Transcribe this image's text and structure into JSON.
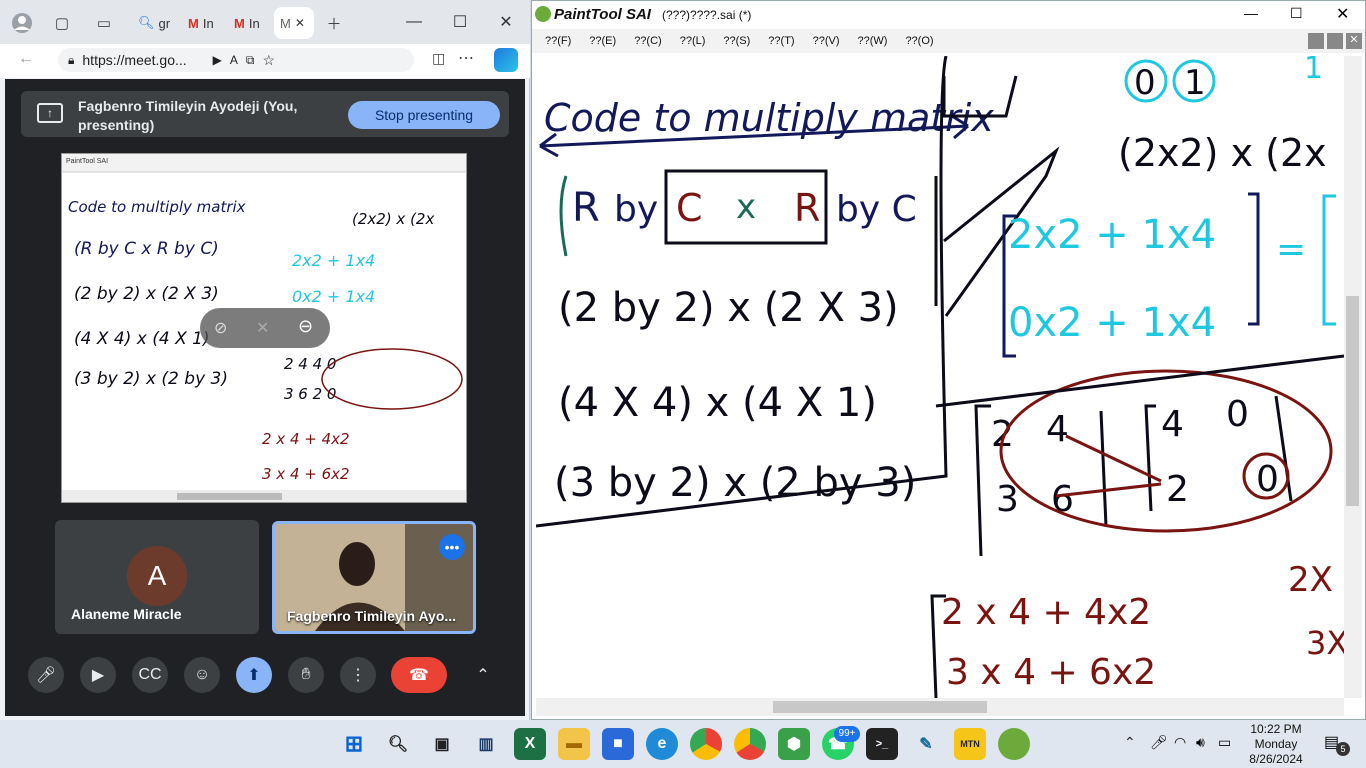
{
  "browser": {
    "tabs": [
      {
        "label": "gr",
        "icon": "search-icon"
      },
      {
        "label": "In",
        "icon": "gmail-icon"
      },
      {
        "label": "In",
        "icon": "gmail-icon"
      },
      {
        "label": "M",
        "icon": "meet-icon"
      }
    ],
    "url": "https://meet.go..."
  },
  "meet": {
    "presenter_banner": "Fagbenro Timileyin Ayodeji (You, presenting)",
    "stop_presenting": "Stop presenting",
    "participants": [
      {
        "name": "Alaneme Miracle",
        "avatar_letter": "A",
        "avatar_color": "#6d3b2c"
      },
      {
        "name": "Fagbenro Timileyin Ayo...",
        "video": true
      }
    ]
  },
  "sai": {
    "logo": "PaintTool SAI",
    "title": "(???)????.sai (*)",
    "menu": [
      "??(F)",
      "??(E)",
      "??(C)",
      "??(L)",
      "??(S)",
      "??(T)",
      "??(V)",
      "??(W)",
      "??(O)"
    ],
    "handwriting": {
      "heading": "Code to multiply matrix",
      "rule_r": "R",
      "rule_by1": "by",
      "rule_c1": "C",
      "rule_x": "x",
      "rule_r2": "R",
      "rule_by2": "by C",
      "line1": "(2 by 2) x (2 X 3)",
      "line2": "(4 X 4) x (4 X 1)",
      "line3": "(3 by 2) x (2 by 3)",
      "top_cells_0": "0",
      "top_cells_1": "1",
      "top_cells_r": "1",
      "top_expr": "(2x2) x (2x",
      "cyan_row1": "2x2 + 1x4",
      "cyan_row2": "0x2 + 1x4",
      "eq": "=",
      "m_a11": "2",
      "m_a12": "4",
      "m_a21": "3",
      "m_a22": "6",
      "m_b11": "4",
      "m_b12": "0",
      "m_b21": "2",
      "m_b22": "0",
      "red_row1": "2 x 4 + 4x2",
      "red_row2": "3 x 4 + 6x2",
      "red_side1": "2X",
      "red_side2": "3X"
    },
    "colors": {
      "ink": "#0b0b1a",
      "navy": "#12185a",
      "cyan": "#1ec8e0",
      "maroon": "#7a1410"
    }
  },
  "taskbar": {
    "time": "10:22 PM",
    "day": "Monday",
    "date": "8/26/2024",
    "whatsapp_badge": "99+",
    "notif_count": "5"
  }
}
